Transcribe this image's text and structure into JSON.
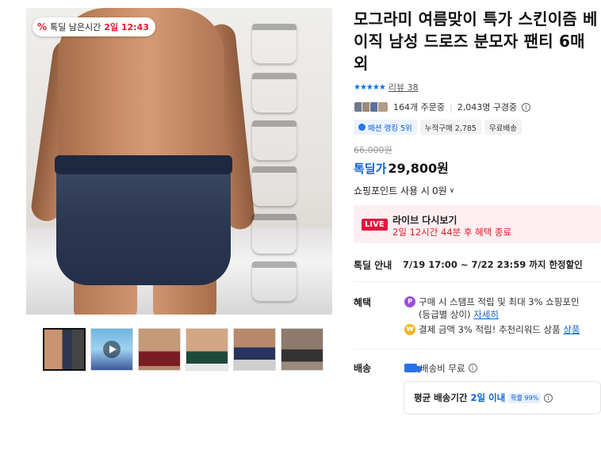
{
  "gallery": {
    "timer_badge": {
      "prefix_icon": "percent-icon",
      "label": "톡딜 남은시간",
      "time": "2일 12:43"
    },
    "swatch_colors": [
      "#1d1d1f",
      "#6b6056",
      "#28345d",
      "#1f4a3a",
      "#7a1c24",
      "#7c5b40"
    ],
    "thumbnails": [
      {
        "name": "thumb-1",
        "active": true
      },
      {
        "name": "thumb-video",
        "video": true
      },
      {
        "name": "thumb-3"
      },
      {
        "name": "thumb-4"
      },
      {
        "name": "thumb-5"
      },
      {
        "name": "thumb-6"
      }
    ]
  },
  "product": {
    "title": "모그라미 여름맞이 특가 스킨이즘 베이직 남성 드로즈 분모자 팬티 6매 외",
    "rating_stars": "★★★★★",
    "review_label": "리뷰 38",
    "orders": "164개 주문중",
    "buyers": "2,043명 구경중",
    "tags": [
      "패션 랭킹 5위",
      "누적구매 2,785",
      "무료배송"
    ],
    "original_price": "66,000원",
    "deal_label": "톡딜가",
    "price": "29,800원",
    "points_label": "쇼핑포인트 사용 시",
    "points_value": "0원"
  },
  "live": {
    "badge": "LIVE",
    "title": "라이브 다시보기",
    "subtitle": "2일 12시간 44분 후 혜택 종료"
  },
  "deal_info": {
    "label": "톡딜 안내",
    "period": "7/19 17:00 ~ 7/22 23:59 까지 한정할인"
  },
  "benefits": {
    "label": "혜택",
    "item1_text": "구매 시 스탬프 적립 및 최대 3% 쇼핑포인",
    "item1_text2": "(등급별 상이)",
    "item1_link": "자세히",
    "item2_text": "결제 금액 3% 적립! 추천리워드 상품",
    "item2_link": "상품"
  },
  "shipping": {
    "label": "배송",
    "fee": "배송비 무료",
    "avg_label": "평균 배송기간",
    "avg_value": "2일 이내",
    "probability": "확률 99%"
  }
}
